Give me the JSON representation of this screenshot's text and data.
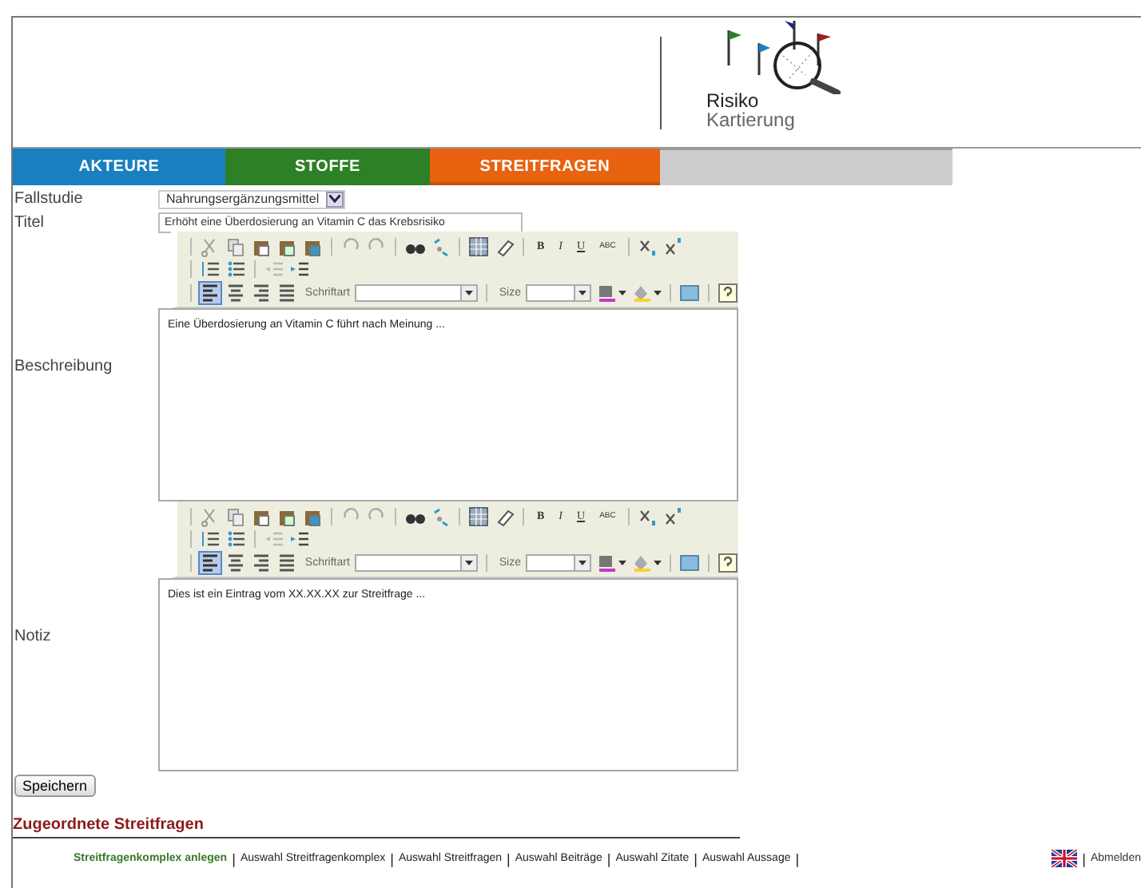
{
  "logo": {
    "line1": "Risiko",
    "line2": "Kartierung"
  },
  "tabs": [
    {
      "label": "AKTEURE",
      "color": "#1a7fc1",
      "selected": false
    },
    {
      "label": "STOFFE",
      "color": "#2e8026",
      "selected": false
    },
    {
      "label": "STREITFRAGEN",
      "color": "#e8620f",
      "selected": true
    }
  ],
  "form": {
    "case_label": "Fallstudie",
    "case_value": "Nahrungsergänzungsmittel",
    "title_label": "Titel",
    "title_value": "Erhöht eine Überdosierung an Vitamin C das Krebsrisiko"
  },
  "editors": [
    {
      "label": "Beschreibung",
      "format_buttons": [
        "B",
        "I",
        "U",
        "ABC"
      ],
      "font_label": "Schriftart",
      "size_label": "Size",
      "align_buttons": [
        {
          "selected": true
        },
        {
          "selected": false
        },
        {
          "selected": false
        },
        {
          "selected": false
        }
      ],
      "content": "Eine Überdosierung an Vitamin C führt nach Meinung ..."
    },
    {
      "label": "Notiz",
      "format_buttons": [
        "B",
        "I",
        "U",
        "ABC"
      ],
      "font_label": "Schriftart",
      "size_label": "Size",
      "align_buttons": [
        {
          "selected": true
        },
        {
          "selected": false
        },
        {
          "selected": false
        },
        {
          "selected": false
        }
      ],
      "content": "Dies ist ein Eintrag vom XX.XX.XX zur Streitfrage ..."
    }
  ],
  "save_button": "Speichern",
  "section_heading": "Zugeordnete Streitfragen",
  "footer_links": [
    {
      "label": "Streitfragenkomplex anlegen",
      "selected": true
    },
    {
      "label": "Auswahl Streitfragenkomplex",
      "selected": false
    },
    {
      "label": "Auswahl Streitfragen",
      "selected": false
    },
    {
      "label": "Auswahl Beiträge",
      "selected": false
    },
    {
      "label": "Auswahl Zitate",
      "selected": false
    },
    {
      "label": "Auswahl Aussage",
      "selected": false
    }
  ],
  "separator": "|",
  "logout": "Abmelden"
}
